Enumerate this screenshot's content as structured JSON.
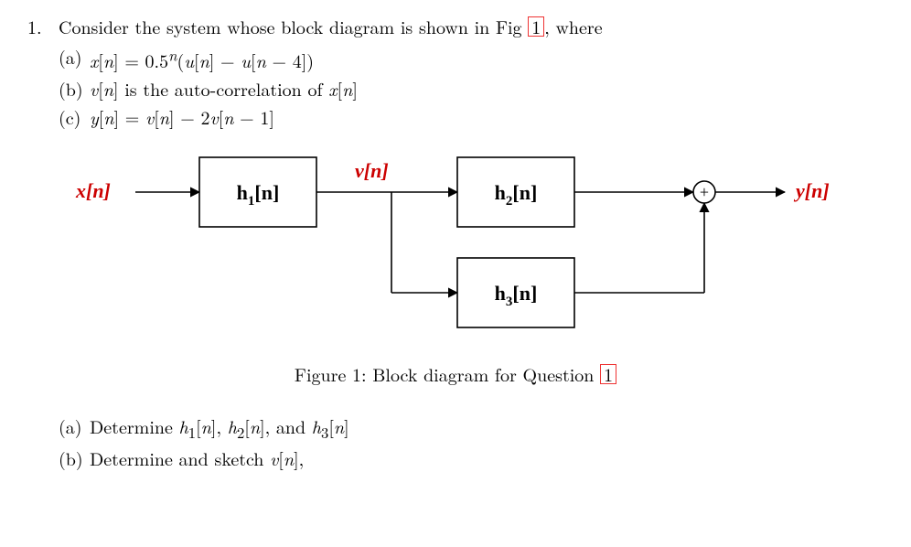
{
  "question": {
    "number": "1.",
    "prompt_pre": "Consider the system whose block diagram is shown in Fig ",
    "figref": "1",
    "prompt_post": ", where",
    "given": {
      "a": {
        "label": "(a)",
        "text": "x[n] = 0.5ⁿ(u[n] − u[n − 4])"
      },
      "b": {
        "label": "(b)",
        "text_pre": "v[n]",
        "text_post": " is the auto-correlation of x[n]"
      },
      "c": {
        "label": "(c)",
        "text": "y[n] = v[n] − 2v[n − 1]"
      }
    }
  },
  "diagram": {
    "x": "x[n]",
    "v": "v[n]",
    "y": "y[n]",
    "h1_base": "h",
    "h1_sub": "1",
    "h1_arg": "[n]",
    "h2_base": "h",
    "h2_sub": "2",
    "h2_arg": "[n]",
    "h3_base": "h",
    "h3_sub": "3",
    "h3_arg": "[n]"
  },
  "figure": {
    "caption_pre": "Figure 1: Block diagram for Question ",
    "ref": "1"
  },
  "parts": {
    "a": {
      "label": "(a)",
      "text": "Determine h₁[n], h₂[n], and h₃[n]"
    },
    "b": {
      "label": "(b)",
      "text": "Determine and sketch v[n],"
    }
  }
}
